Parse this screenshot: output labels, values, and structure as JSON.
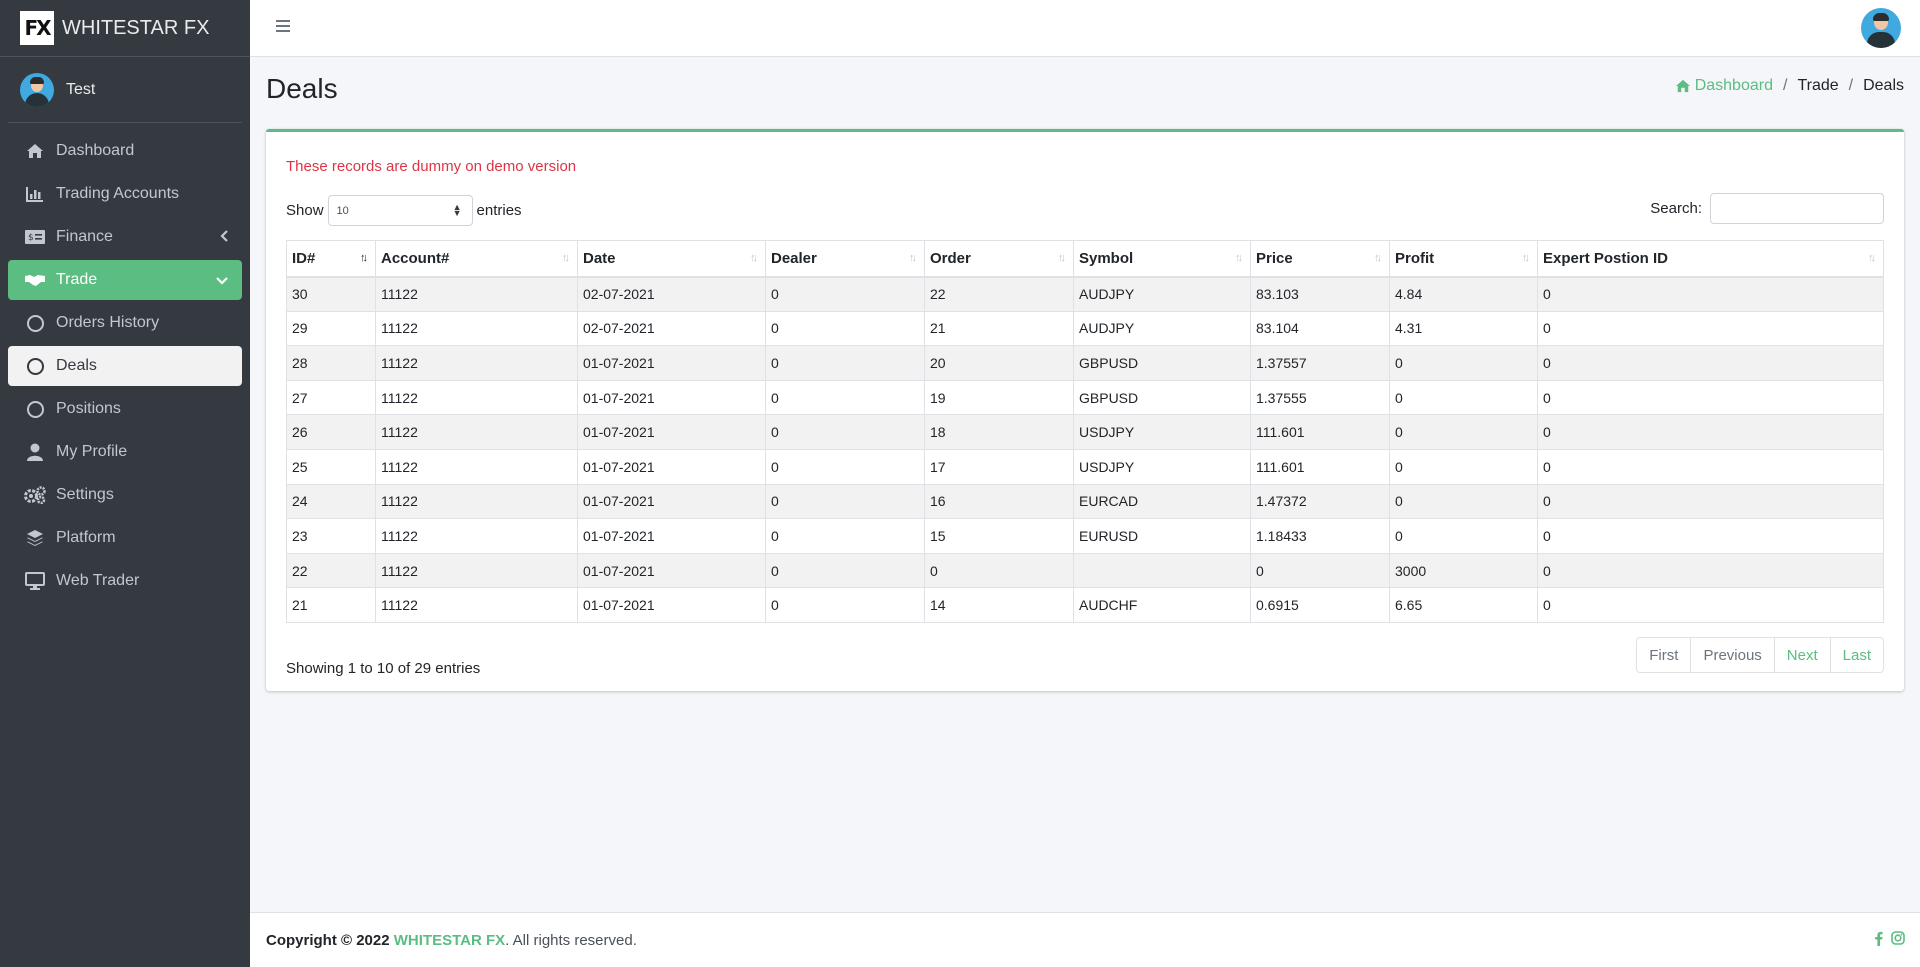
{
  "brand": {
    "logo": "FX",
    "name": "WHITESTAR FX"
  },
  "user": {
    "name": "Test"
  },
  "sidebar": {
    "items": [
      {
        "label": "Dashboard",
        "icon": "home-icon"
      },
      {
        "label": "Trading Accounts",
        "icon": "bar-chart-icon"
      },
      {
        "label": "Finance",
        "icon": "money-bill-icon"
      },
      {
        "label": "Trade",
        "icon": "handshake-icon"
      },
      {
        "label": "Orders History",
        "icon": "circle-icon"
      },
      {
        "label": "Deals",
        "icon": "circle-icon"
      },
      {
        "label": "Positions",
        "icon": "circle-icon"
      },
      {
        "label": "My Profile",
        "icon": "user-icon"
      },
      {
        "label": "Settings",
        "icon": "cogs-icon"
      },
      {
        "label": "Platform",
        "icon": "layers-icon"
      },
      {
        "label": "Web Trader",
        "icon": "desktop-icon"
      }
    ]
  },
  "page": {
    "title": "Deals",
    "breadcrumb": {
      "home": "Dashboard",
      "section": "Trade",
      "current": "Deals",
      "separator": "/"
    }
  },
  "card": {
    "notice": "These records are dummy on demo version",
    "show_label": "Show",
    "entries_label": "entries",
    "page_length": "10",
    "search_label": "Search:",
    "search_value": ""
  },
  "table": {
    "columns": [
      "ID#",
      "Account#",
      "Date",
      "Dealer",
      "Order",
      "Symbol",
      "Price",
      "Profit",
      "Expert Postion ID"
    ],
    "rows": [
      [
        "30",
        "11122",
        "02-07-2021",
        "0",
        "22",
        "AUDJPY",
        "83.103",
        "4.84",
        "0"
      ],
      [
        "29",
        "11122",
        "02-07-2021",
        "0",
        "21",
        "AUDJPY",
        "83.104",
        "4.31",
        "0"
      ],
      [
        "28",
        "11122",
        "01-07-2021",
        "0",
        "20",
        "GBPUSD",
        "1.37557",
        "0",
        "0"
      ],
      [
        "27",
        "11122",
        "01-07-2021",
        "0",
        "19",
        "GBPUSD",
        "1.37555",
        "0",
        "0"
      ],
      [
        "26",
        "11122",
        "01-07-2021",
        "0",
        "18",
        "USDJPY",
        "111.601",
        "0",
        "0"
      ],
      [
        "25",
        "11122",
        "01-07-2021",
        "0",
        "17",
        "USDJPY",
        "111.601",
        "0",
        "0"
      ],
      [
        "24",
        "11122",
        "01-07-2021",
        "0",
        "16",
        "EURCAD",
        "1.47372",
        "0",
        "0"
      ],
      [
        "23",
        "11122",
        "01-07-2021",
        "0",
        "15",
        "EURUSD",
        "1.18433",
        "0",
        "0"
      ],
      [
        "22",
        "11122",
        "01-07-2021",
        "0",
        "0",
        "",
        "0",
        "3000",
        "0"
      ],
      [
        "21",
        "11122",
        "01-07-2021",
        "0",
        "14",
        "AUDCHF",
        "0.6915",
        "6.65",
        "0"
      ]
    ],
    "info": "Showing 1 to 10 of 29 entries"
  },
  "pagination": {
    "first": "First",
    "previous": "Previous",
    "next": "Next",
    "last": "Last"
  },
  "footer": {
    "prefix": "Copyright © 2022 ",
    "brand": "WHITESTAR FX",
    "suffix": ". All rights reserved."
  },
  "colors": {
    "accent": "#5bbd82",
    "sidebar_bg": "#343a40",
    "danger": "#dc3545"
  }
}
